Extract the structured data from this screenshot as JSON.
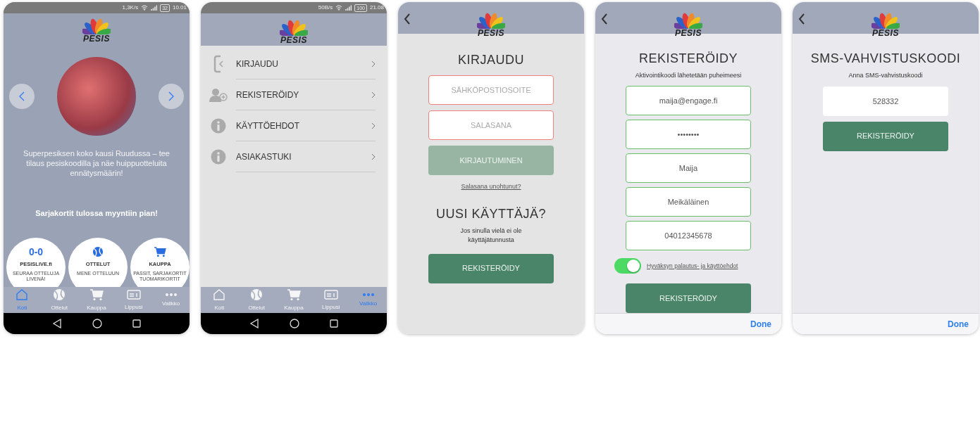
{
  "screens": [
    {
      "kind": "home",
      "status_bar": {
        "speed": "1,3K/s",
        "battery": "32",
        "time": "10.01"
      },
      "logo": "PESIS",
      "promo": "Superpesiksen koko kausi Ruudussa – tee tilaus pesiskoodilla ja näe huippuotteluita ennätysmäärin!",
      "notice": "Sarjakortit tulossa myyntiin pian!",
      "tiles": [
        {
          "kind": "score",
          "score": "0-0",
          "title": "PESISLIVE.fi",
          "subtitle": "SEURAA OTTELUJA LIVENÄ!"
        },
        {
          "kind": "ball",
          "title": "OTTELUT",
          "subtitle": "MENE OTTELUUN"
        },
        {
          "kind": "cart",
          "title": "KAUPPA",
          "subtitle": "PASSIT, SARJAKORTIT TUOMARIKORTIT"
        }
      ],
      "tabbar": [
        {
          "label": "Koti",
          "selected": true
        },
        {
          "label": "Ottelut",
          "selected": false
        },
        {
          "label": "Kauppa",
          "selected": false
        },
        {
          "label": "Lippusi",
          "selected": false
        },
        {
          "label": "Valikko",
          "selected": false
        }
      ]
    },
    {
      "kind": "menu",
      "status_bar": {
        "speed": "50B/s",
        "battery": "100",
        "time": "21.08"
      },
      "logo": "PESIS",
      "menu": [
        {
          "label": "KIRJAUDU"
        },
        {
          "label": "REKISTERÖIDY"
        },
        {
          "label": "KÄYTTÖEHDOT"
        },
        {
          "label": "ASIAKASTUKI"
        }
      ],
      "tabbar": [
        {
          "label": "Koti",
          "selected": false
        },
        {
          "label": "Ottelut",
          "selected": false
        },
        {
          "label": "Kauppa",
          "selected": false
        },
        {
          "label": "Lippusi",
          "selected": false
        },
        {
          "label": "Valikko",
          "selected": true
        }
      ]
    },
    {
      "kind": "login",
      "logo": "PESIS",
      "title": "KIRJAUDU",
      "fields": [
        {
          "placeholder": "SÄHKÖPOSTIOSOITE",
          "error": true
        },
        {
          "placeholder": "SALASANA",
          "error": true
        }
      ],
      "submit": {
        "label": "KIRJAUTUMINEN",
        "disabled": true
      },
      "link": "Salasana unohtunut?",
      "subtitle": "UUSI KÄYTTÄJÄ?",
      "text": "Jos sinulla vielä ei ole käyttäjätunnusta",
      "button": "REKISTERÖIDY"
    },
    {
      "kind": "register",
      "logo": "PESIS",
      "title": "REKISTERÖIDY",
      "hint": "Aktivointikoodi lähetetään puheimeesi",
      "fields": [
        {
          "value": "maija@engage.fi",
          "valid": true
        },
        {
          "value": "••••••••",
          "valid": true
        },
        {
          "value": "Maija",
          "valid": true
        },
        {
          "value": "Meikäläinen",
          "valid": true
        },
        {
          "value": "04012345678",
          "valid": true
        }
      ],
      "terms": {
        "label": "Hyväksyn palautus- ja käyttöehdot",
        "on": true
      },
      "button": "REKISTERÖIDY",
      "keyboard_bar": "Done"
    },
    {
      "kind": "sms",
      "logo": "PESIS",
      "title": "SMS-VAHVISTUSKOODI",
      "hint": "Anna SMS-vahvistuskoodi",
      "fields": [
        {
          "value": "528332"
        }
      ],
      "button": "REKISTERÖIDY",
      "keyboard_bar": "Done"
    }
  ]
}
